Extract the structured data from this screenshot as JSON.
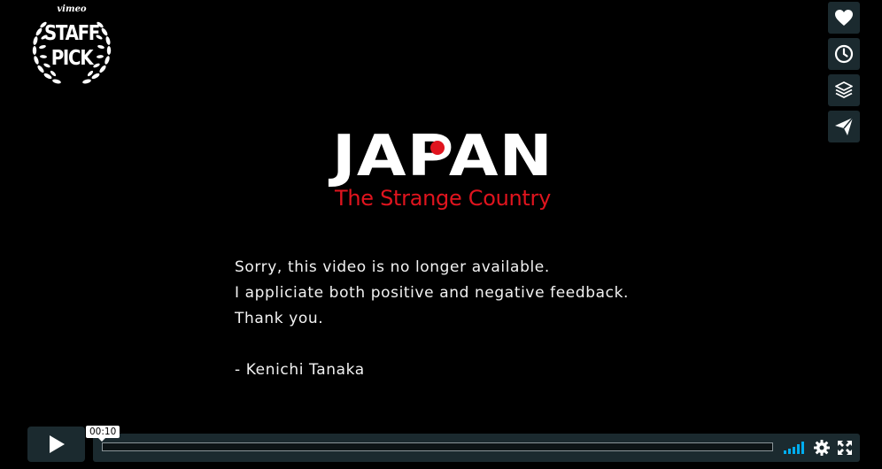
{
  "badge": {
    "brand": "vimeo",
    "line1": "STAFF",
    "line2": "PICK"
  },
  "side_actions": [
    {
      "name": "like",
      "icon": "heart-icon"
    },
    {
      "name": "watch-later",
      "icon": "clock-icon"
    },
    {
      "name": "collections",
      "icon": "layers-icon"
    },
    {
      "name": "share",
      "icon": "paper-plane-icon"
    }
  ],
  "title": {
    "main": "JAPAN",
    "subtitle": "The Strange Country"
  },
  "message": {
    "line1": "Sorry, this video is no longer available.",
    "line2": "I appliciate both positive and negative feedback.",
    "line3": "Thank you.",
    "signature": "- Kenichi Tanaka"
  },
  "controls": {
    "current_time": "00:10",
    "play_icon": "play-icon",
    "volume_icon": "volume-bars-icon",
    "settings_icon": "gear-icon",
    "fullscreen_icon": "fullscreen-icon"
  },
  "colors": {
    "background": "#000000",
    "button_bg": "#1b2a2f",
    "subtitle_red": "#e0141e",
    "volume_blue": "#00adef"
  }
}
